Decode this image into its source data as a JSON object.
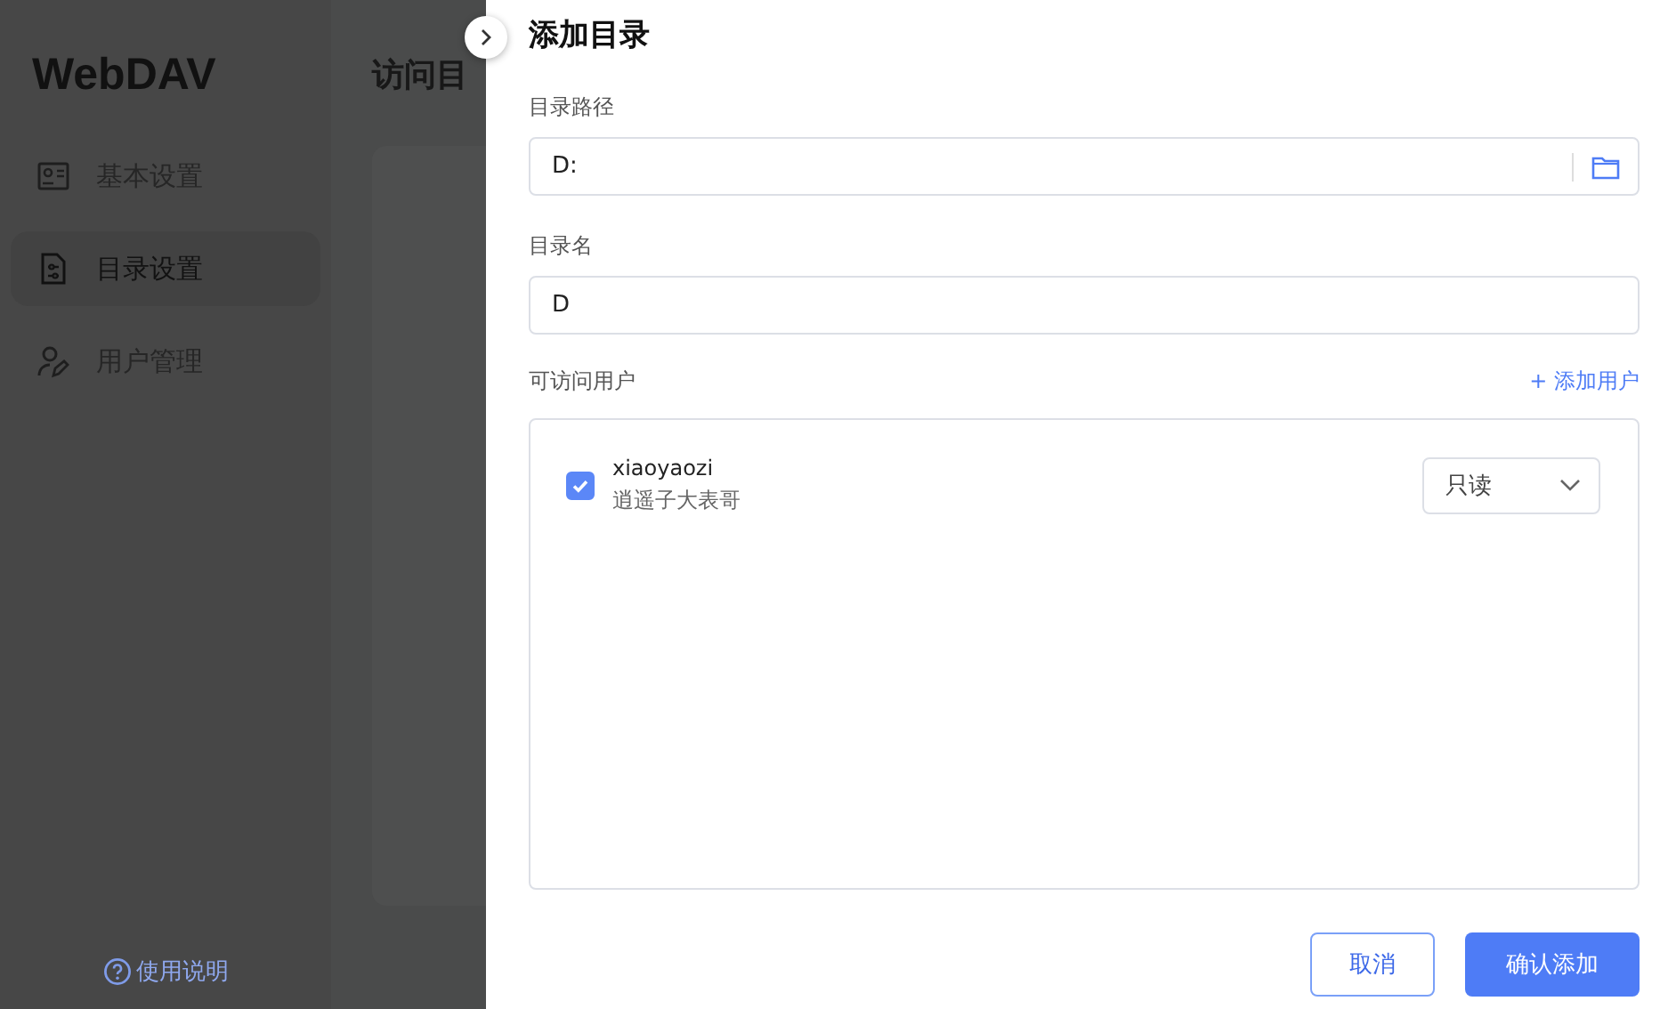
{
  "sidebar": {
    "logo": "WebDAV",
    "items": [
      {
        "label": "基本设置",
        "selected": false
      },
      {
        "label": "目录设置",
        "selected": true
      },
      {
        "label": "用户管理",
        "selected": false
      }
    ],
    "help_link": "使用说明"
  },
  "main": {
    "title": "访问目"
  },
  "drawer": {
    "title": "添加目录",
    "fields": [
      {
        "label": "目录路径",
        "value": "D:",
        "kind": "folder"
      },
      {
        "label": "目录名",
        "value": "D",
        "kind": "text"
      }
    ],
    "users_label": "可访问用户",
    "add_user": "+ 添加用户",
    "users": [
      {
        "name": "xiaoyaozi",
        "nickname": "逍遥子大表哥",
        "checked": true,
        "permission": "只读"
      }
    ],
    "buttons": [
      {
        "label": "取消",
        "kind": "secondary"
      },
      {
        "label": "确认添加",
        "kind": "primary"
      }
    ]
  }
}
